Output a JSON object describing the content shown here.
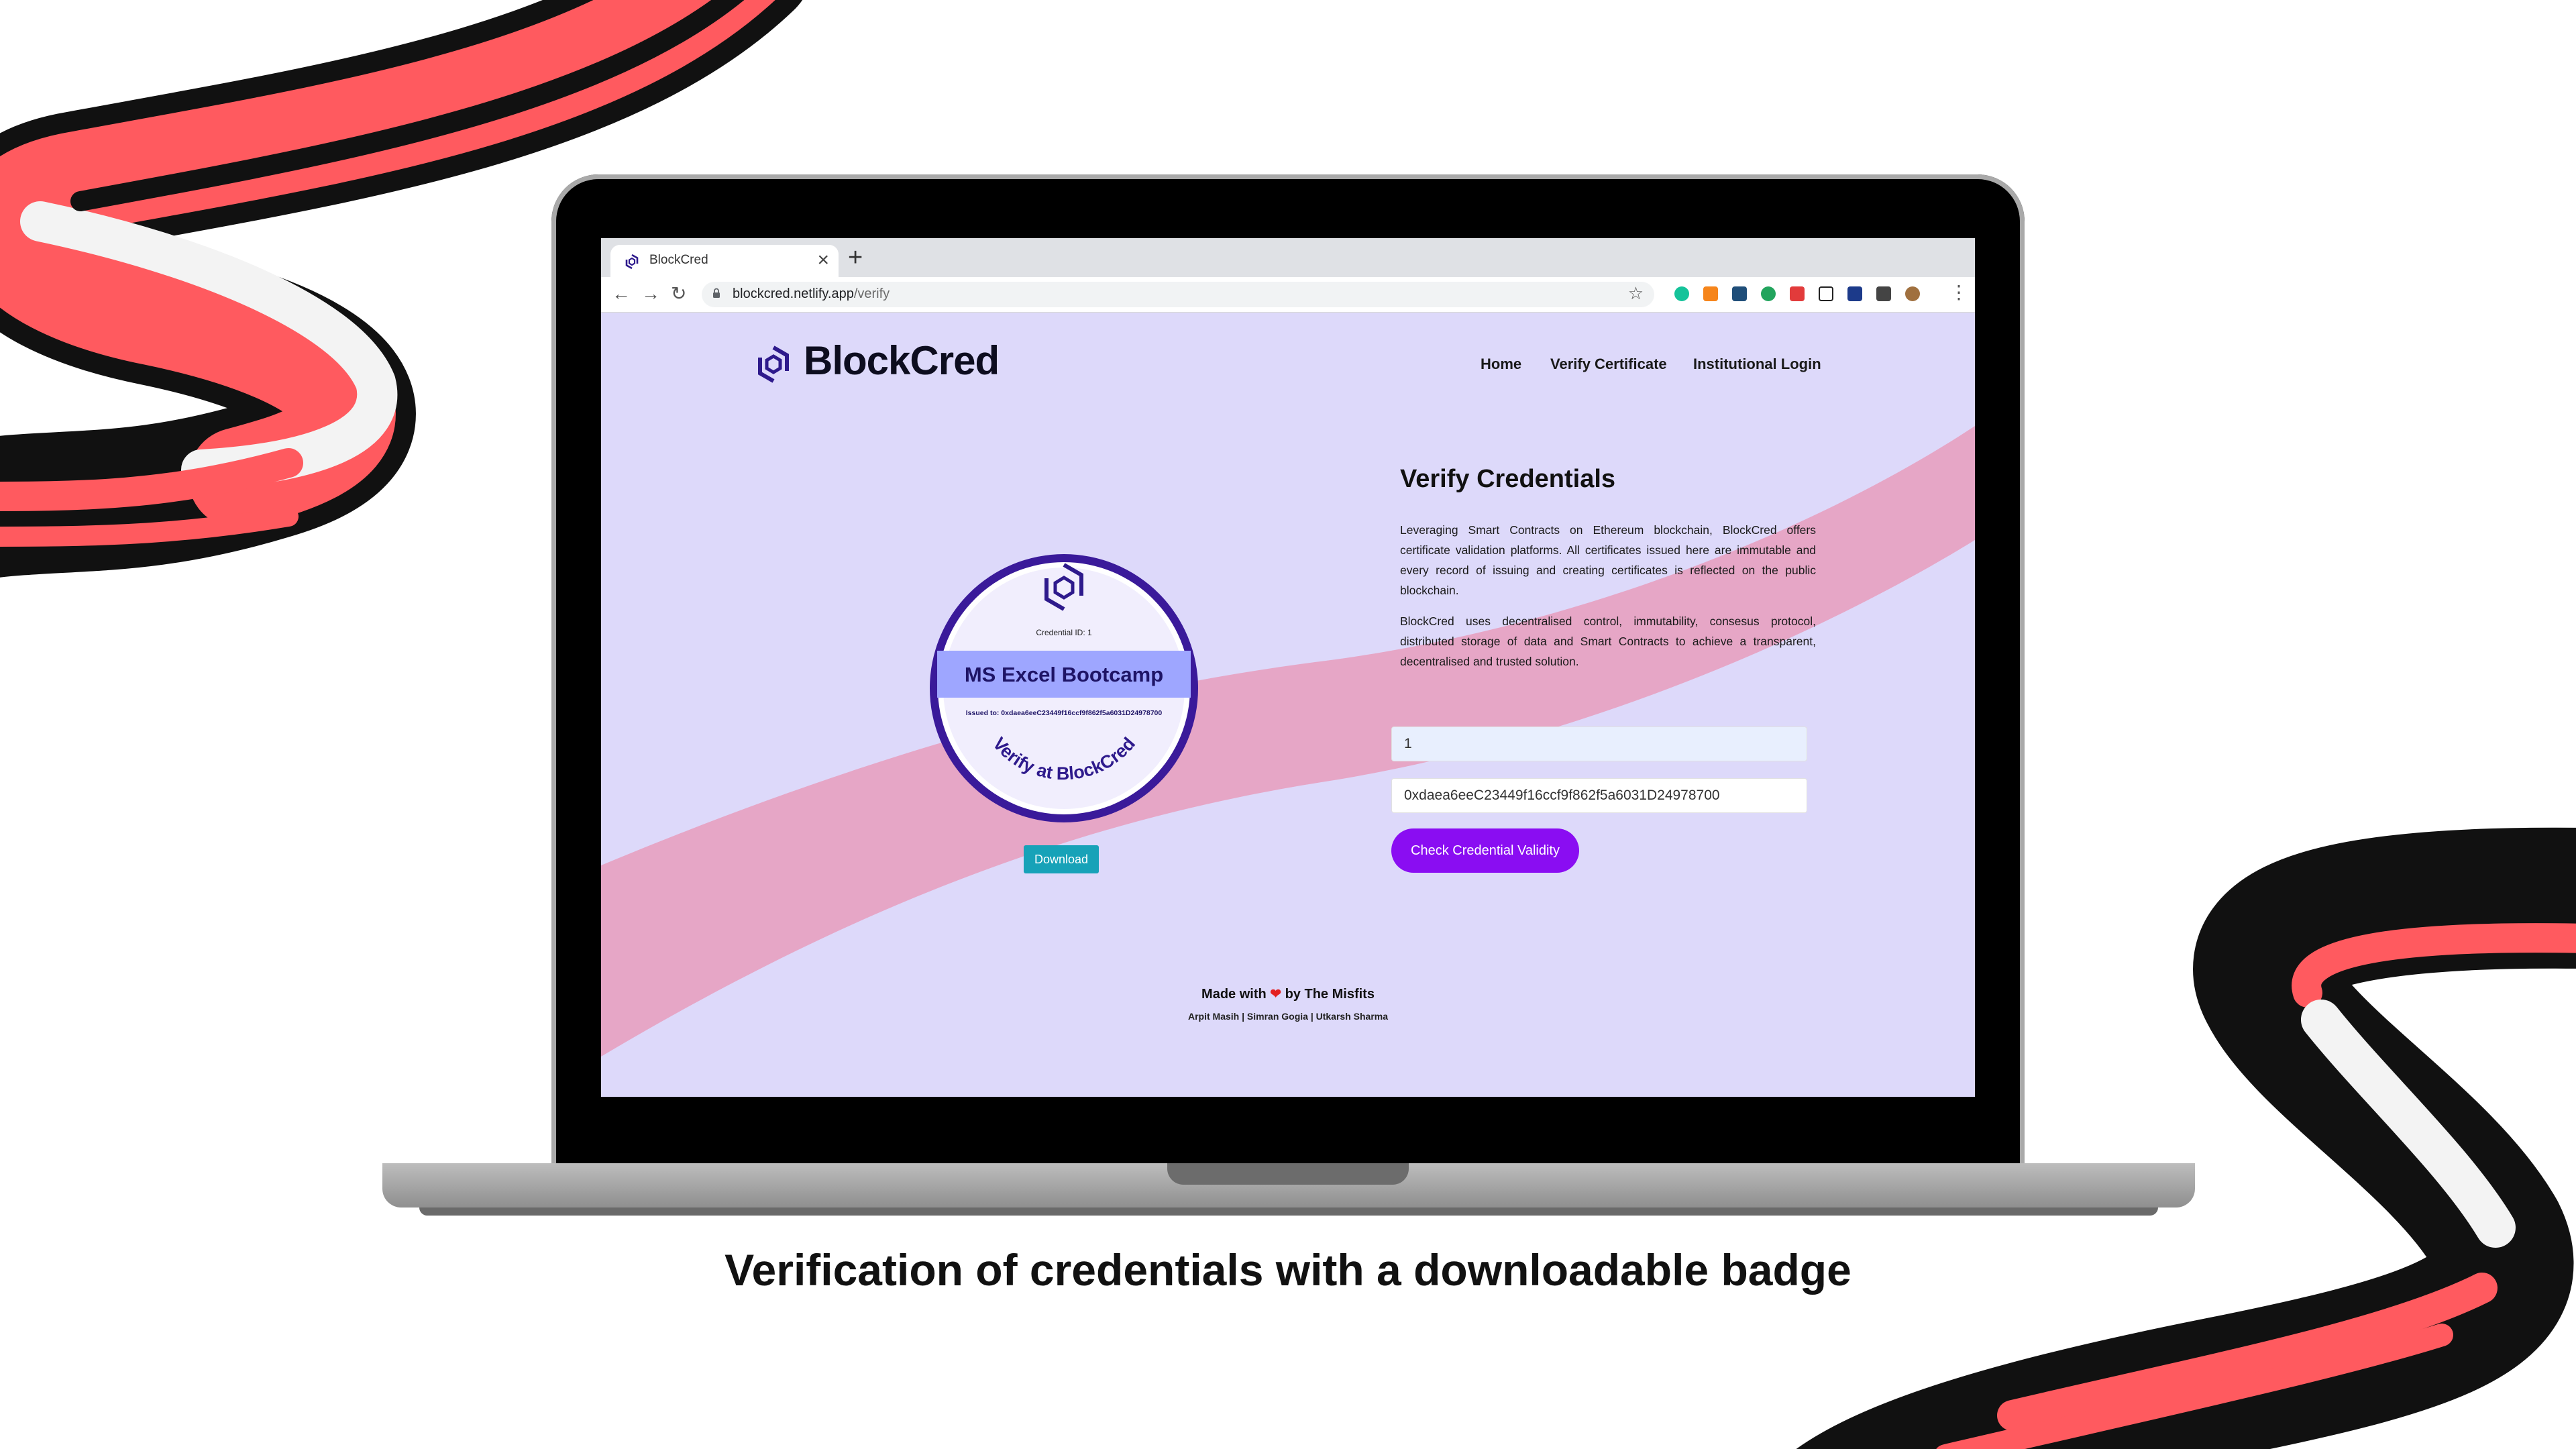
{
  "browser": {
    "tab_title": "BlockCred",
    "tab_close": "×",
    "new_tab": "+",
    "back": "←",
    "forward": "→",
    "reload": "↻",
    "url_host": "blockcred.netlify.app",
    "url_path": "/verify",
    "bookmark_star": "☆",
    "menu": "⋮",
    "extensions": [
      "grammarly-icon",
      "metamask-icon",
      "extension-icon",
      "extension-icon",
      "typing-icon",
      "notion-icon",
      "extension-icon",
      "puzzle-icon",
      "profile-avatar"
    ]
  },
  "header": {
    "logo_text": "BlockCred",
    "nav": [
      "Home",
      "Verify Certificate",
      "Institutional Login"
    ]
  },
  "badge": {
    "credential_id": "Credential ID: 1",
    "title": "MS Excel Bootcamp",
    "issued_to": "Issued to: 0xdaea6eeC23449f16ccf9f862f5a6031D24978700",
    "footer": "Verify at BlockCred"
  },
  "download_label": "Download",
  "verify": {
    "title": "Verify Credentials",
    "paragraph1": "Leveraging Smart Contracts on Ethereum blockchain, BlockCred offers certificate validation platforms. All certificates issued here are immutable and every record of issuing and creating certificates is reflected on the public blockchain.",
    "paragraph2": "BlockCred uses decentralised control, immutability, consesus protocol, distributed storage of data and Smart Contracts to achieve a transparent, decentralised and trusted solution.",
    "credential_id_value": "1",
    "address_value": "0xdaea6eeC23449f16ccf9f862f5a6031D24978700",
    "check_button": "Check Credential Validity"
  },
  "footer": {
    "made_with": "Made with",
    "heart": "❤",
    "by": "by The Misfits",
    "names": "Arpit Masih | Simran Gogia | Utkarsh Sharma"
  },
  "caption": "Verification of credentials with a downloadable badge",
  "colors": {
    "page_bg": "#ddd9fa",
    "wave": "#e6a6c6",
    "brand": "#2e1a8c",
    "accent_purple": "#8a0df2",
    "download_teal": "#17a2b8",
    "ribbon_red": "#ff5a5f",
    "ribbon_black": "#111111"
  }
}
